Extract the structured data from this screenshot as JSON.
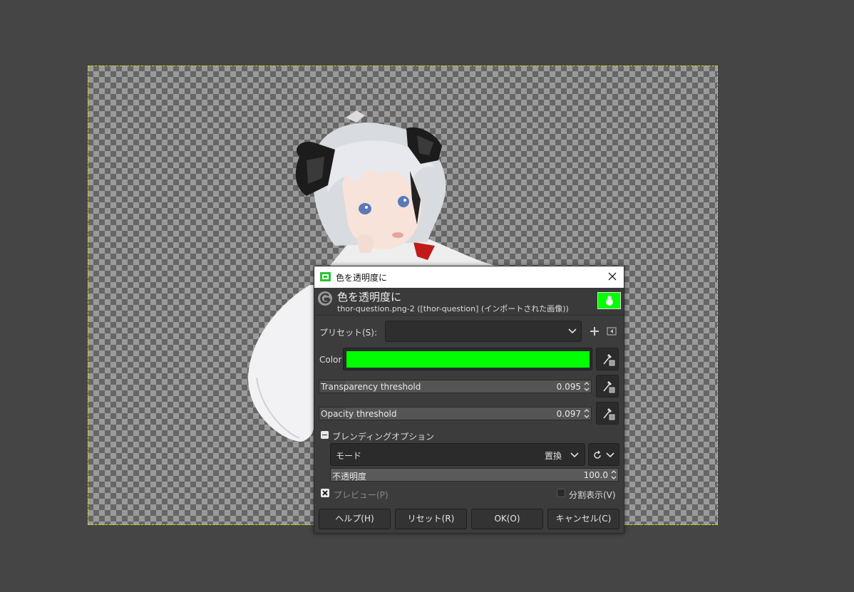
{
  "colors": {
    "workspace_bg": "#454545",
    "dialog_bg": "#3c3c3c",
    "target_color": "#00ff00",
    "canvas_border": "#d9d900"
  },
  "dialog": {
    "window_title": "色を透明度に",
    "header_title": "色を透明度に",
    "header_subtitle": "thor-question.png-2 ([thor-question] (インポートされた画像))",
    "close_icon": "close-icon"
  },
  "presets": {
    "label": "プリセット(S):",
    "value": ""
  },
  "color": {
    "label": "Color",
    "value": "#00ff00"
  },
  "transparency_threshold": {
    "label": "Transparency threshold",
    "value": "0.095",
    "fraction": 0.095
  },
  "opacity_threshold": {
    "label": "Opacity threshold",
    "value": "0.097",
    "fraction": 0.097
  },
  "blending": {
    "section_label": "ブレンディングオプション",
    "mode_label": "モード",
    "mode_value": "置換",
    "opacity_label": "不透明度",
    "opacity_value": "100.0"
  },
  "preview": {
    "label": "プレビュー(P)",
    "checked": true
  },
  "split_view": {
    "label": "分割表示(V)",
    "checked": false
  },
  "buttons": {
    "help": "ヘルプ(H)",
    "reset": "リセット(R)",
    "ok": "OK(O)",
    "cancel": "キャンセル(C)"
  }
}
